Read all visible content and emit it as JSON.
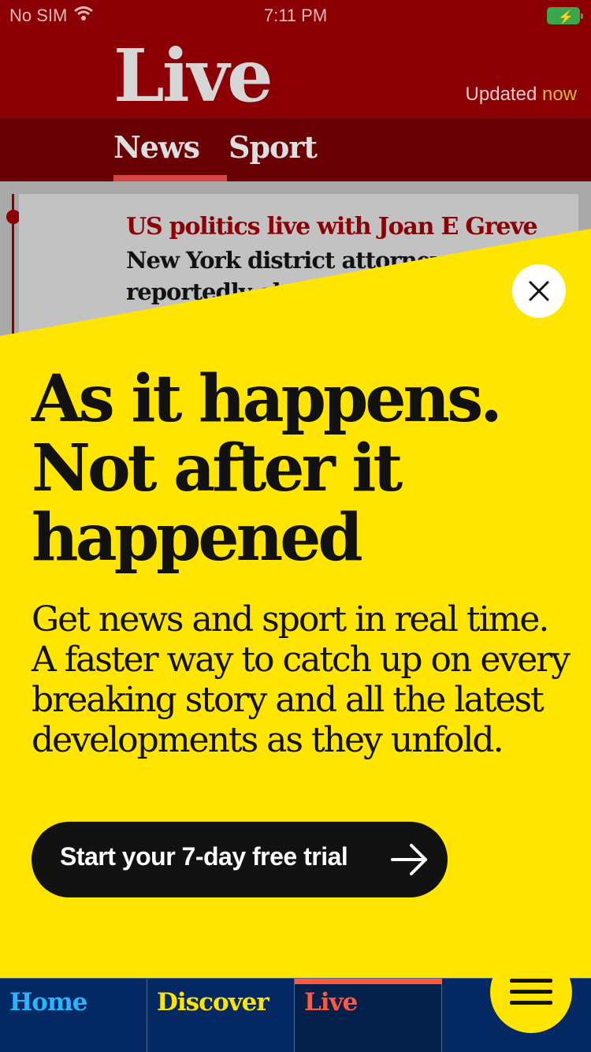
{
  "status_bar": {
    "carrier": "No SIM",
    "time": "7:11 PM",
    "wifi_icon": "wifi-icon",
    "battery_icon": "battery-charging-icon"
  },
  "header": {
    "logo": "Live",
    "updated_label": "Updated",
    "updated_value": "now"
  },
  "tabs": {
    "news": "News",
    "sport": "Sport",
    "active": "News"
  },
  "feed": {
    "card_kicker": "US politics live with Joan E Greve",
    "card_headline": "New York district attorney reportedly obtains Trump's financial records"
  },
  "promo": {
    "heading": "As it happens. Not after it happened",
    "body": "Get news and sport in real time. A faster way to catch up on every breaking story and all the latest developments as they unfold.",
    "cta_label": "Start your 7-day free trial",
    "close_icon": "close-icon",
    "arrow_icon": "arrow-right-icon"
  },
  "bottom_nav": {
    "home": "Home",
    "discover": "Discover",
    "live": "Live",
    "active": "Live",
    "menu_icon": "hamburger-menu-icon"
  },
  "colors": {
    "header_red": "#8b0005",
    "tab_bar_red": "#680004",
    "promo_yellow": "#ffe500",
    "nav_blue": "#052962",
    "live_accent": "#ff5943",
    "home_blue": "#28b4ff"
  }
}
